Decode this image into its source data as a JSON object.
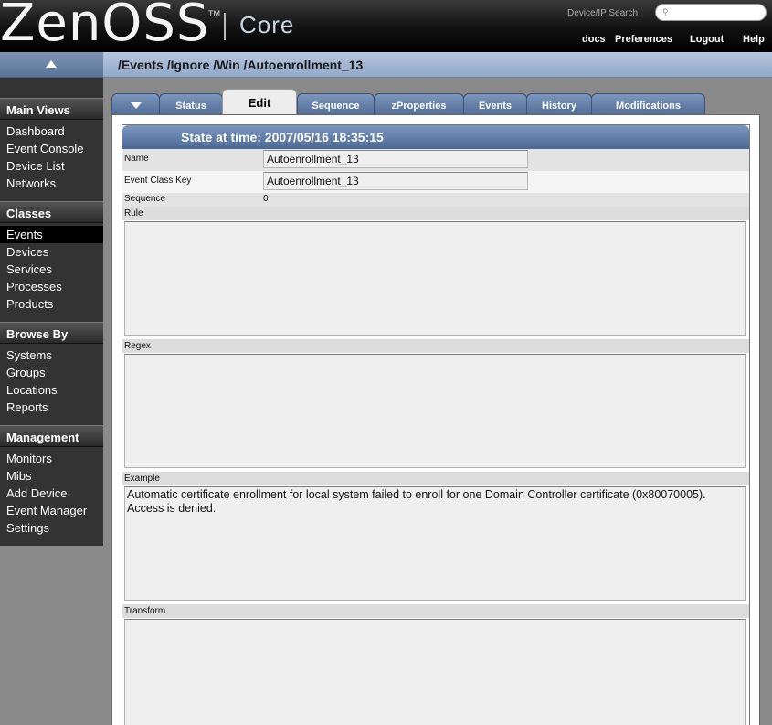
{
  "header": {
    "logo_text": "ZenOSS",
    "logo_tm": "TM",
    "product": "Core",
    "search_label": "Device/IP Search",
    "search_placeholder": "",
    "links": [
      "docs",
      "Preferences",
      "Logout",
      "Help"
    ]
  },
  "breadcrumb": "/Events /Ignore /Win /Autoenrollment_13",
  "sidebar": {
    "sections": [
      {
        "title": "Main Views",
        "items": [
          "Dashboard",
          "Event Console",
          "Device List",
          "Networks"
        ]
      },
      {
        "title": "Classes",
        "items": [
          "Events",
          "Devices",
          "Services",
          "Processes",
          "Products"
        ]
      },
      {
        "title": "Browse By",
        "items": [
          "Systems",
          "Groups",
          "Locations",
          "Reports"
        ]
      },
      {
        "title": "Management",
        "items": [
          "Monitors",
          "Mibs",
          "Add Device",
          "Event Manager",
          "Settings"
        ]
      }
    ],
    "active_item": "Events"
  },
  "tabs": [
    "",
    "Status",
    "Edit",
    "Sequence",
    "zProperties",
    "Events",
    "History",
    "Modifications"
  ],
  "active_tab": "Edit",
  "form": {
    "state_title": "State at time: 2007/05/16 18:35:15",
    "name_label": "Name",
    "name_value": "Autoenrollment_13",
    "event_class_key_label": "Event Class Key",
    "event_class_key_value": "Autoenrollment_13",
    "sequence_label": "Sequence",
    "sequence_value": "0",
    "rule_label": "Rule",
    "rule_value": "",
    "regex_label": "Regex",
    "regex_value": "",
    "example_label": "Example",
    "example_value": "Automatic certificate enrollment for local system failed to enroll for one Domain Controller certificate (0x80070005). Access is denied.",
    "transform_label": "Transform",
    "transform_value": ""
  },
  "colors": {
    "header_bg": "#000000",
    "accent_blue": "#5b7396",
    "sidebar_bg": "#333333"
  }
}
